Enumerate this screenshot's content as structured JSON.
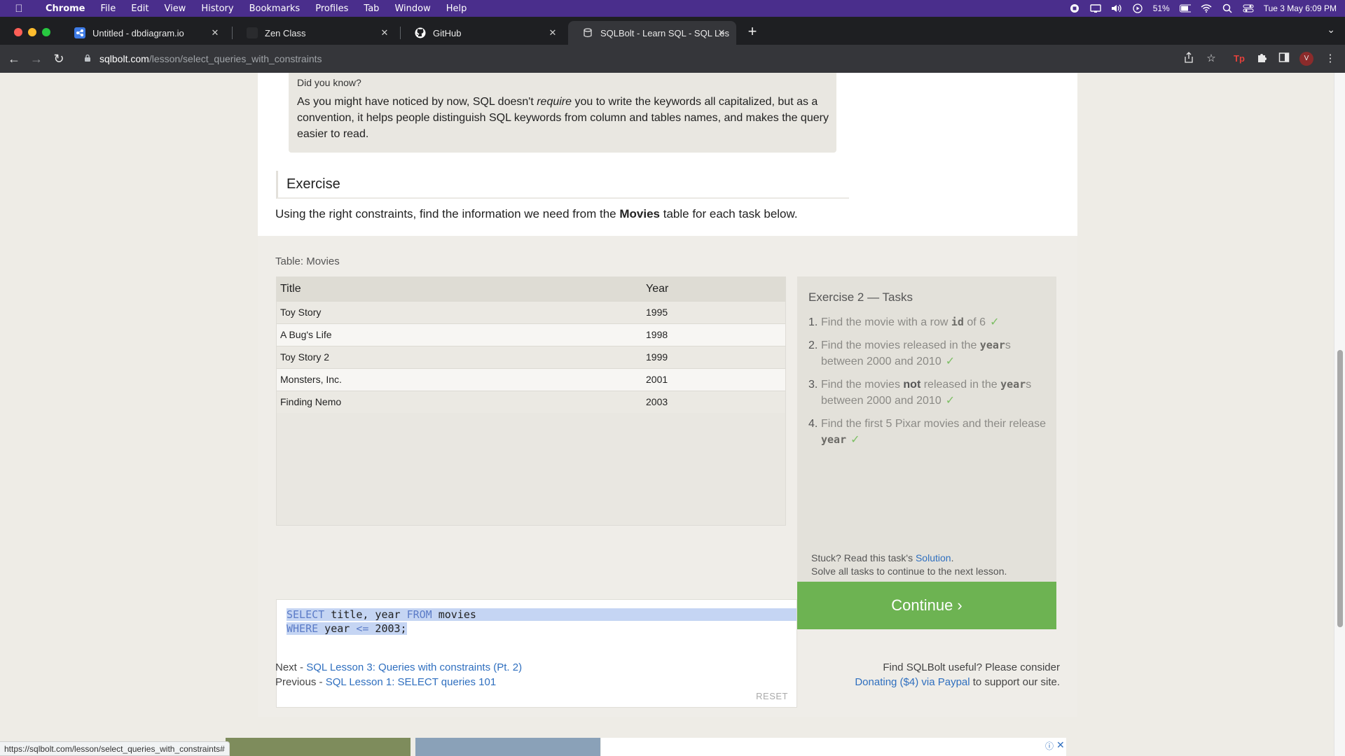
{
  "menubar": {
    "app": "Chrome",
    "items": [
      "File",
      "Edit",
      "View",
      "History",
      "Bookmarks",
      "Profiles",
      "Tab",
      "Window",
      "Help"
    ],
    "battery": "51%",
    "datetime": "Tue 3 May  6:09 PM"
  },
  "tabs": [
    {
      "title": "Untitled - dbdiagram.io",
      "icon": "dbdiagram-icon"
    },
    {
      "title": "Zen Class",
      "icon": "zen-class-icon"
    },
    {
      "title": "GitHub",
      "icon": "github-icon"
    },
    {
      "title": "SQLBolt - Learn SQL - SQL Les",
      "icon": "sqlbolt-icon"
    }
  ],
  "toolbar": {
    "url_host": "sqlbolt.com",
    "url_path": "/lesson/select_queries_with_constraints",
    "profile_initial": "V"
  },
  "did_you_know": {
    "title": "Did you know?",
    "body_before": "As you might have noticed by now, SQL doesn't ",
    "body_em": "require",
    "body_after": " you to write the keywords all capitalized, but as a convention, it helps people distinguish SQL keywords from column and tables names, and makes the query easier to read."
  },
  "exercise": {
    "heading": "Exercise",
    "desc_before": "Using the right constraints, find the information we need from the ",
    "desc_bold": "Movies",
    "desc_after": " table for each task below."
  },
  "table": {
    "label": "Table: Movies",
    "columns": [
      "Title",
      "Year"
    ],
    "rows": [
      [
        "Toy Story",
        "1995"
      ],
      [
        "A Bug's Life",
        "1998"
      ],
      [
        "Toy Story 2",
        "1999"
      ],
      [
        "Monsters, Inc.",
        "2001"
      ],
      [
        "Finding Nemo",
        "2003"
      ]
    ]
  },
  "tasks": {
    "title": "Exercise 2 — Tasks",
    "items": [
      {
        "num": "1.",
        "a": "Find the movie with a row ",
        "code": "id",
        "b": " of 6",
        "check": "✓"
      },
      {
        "num": "2.",
        "a": "Find the movies released in the ",
        "code": "year",
        "b": "s between 2000 and 2010",
        "check": "✓"
      },
      {
        "num": "3.",
        "a": "Find the movies ",
        "bold": "not",
        "a2": " released in the ",
        "code": "year",
        "b": "s between 2000 and 2010",
        "check": "✓"
      },
      {
        "num": "4.",
        "a": "Find the first 5 Pixar movies and their release ",
        "code": "year",
        "b": "",
        "check": "✓"
      }
    ],
    "stuck_before": "Stuck? Read this task's ",
    "stuck_link": "Solution",
    "stuck_after": ".",
    "solve_all": "Solve all tasks to continue to the next lesson.",
    "continue_label": "Continue ›"
  },
  "editor": {
    "line1": {
      "kw1": "SELECT",
      "rest1": " title, year ",
      "kw2": "FROM",
      "rest2": " movies"
    },
    "line2": {
      "kw1": "WHERE",
      "rest1": " year ",
      "kw2": "<=",
      "rest2": " 2003;"
    },
    "reset_label": "RESET"
  },
  "footer": {
    "next_prefix": "Next - ",
    "next_link": "SQL Lesson 3: Queries with constraints (Pt. 2)",
    "prev_prefix": "Previous - ",
    "prev_link": "SQL Lesson 1: SELECT queries 101",
    "useful": "Find SQLBolt useful? Please consider",
    "donate_link": "Donating ($4) via Paypal",
    "donate_after": " to support our site."
  },
  "statusbar": "https://sqlbolt.com/lesson/select_queries_with_constraints#"
}
